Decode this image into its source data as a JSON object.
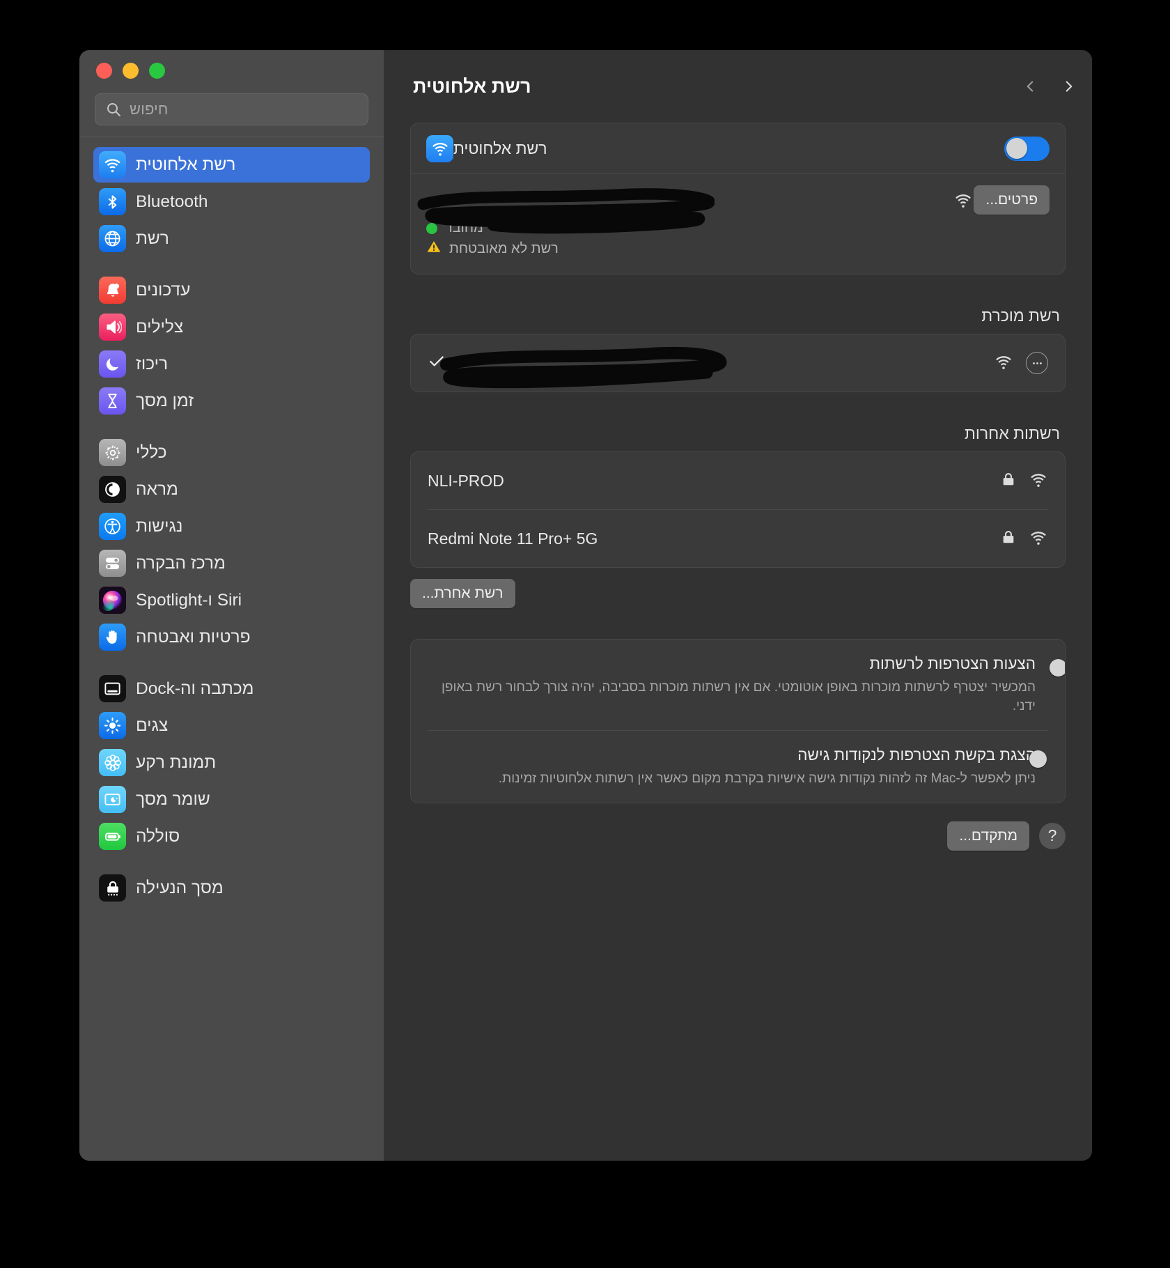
{
  "window": {
    "traffic_lights": [
      "close",
      "minimize",
      "zoom"
    ],
    "accent_color": "#3b72d9"
  },
  "search": {
    "placeholder": "חיפוש",
    "value": "",
    "icon": "search-icon"
  },
  "sidebar": {
    "groups": [
      {
        "items": [
          {
            "label": "רשת אלחוטית",
            "icon": "wifi-icon",
            "selected": true
          },
          {
            "label": "Bluetooth",
            "icon": "bluetooth-icon",
            "selected": false
          },
          {
            "label": "רשת",
            "icon": "globe-icon",
            "selected": false
          }
        ]
      },
      {
        "items": [
          {
            "label": "עדכונים",
            "icon": "bell-icon",
            "selected": false
          },
          {
            "label": "צלילים",
            "icon": "speaker-icon",
            "selected": false
          },
          {
            "label": "ריכוז",
            "icon": "moon-icon",
            "selected": false
          },
          {
            "label": "זמן מסך",
            "icon": "hourglass-icon",
            "selected": false
          }
        ]
      },
      {
        "items": [
          {
            "label": "כללי",
            "icon": "gear-icon",
            "selected": false
          },
          {
            "label": "מראה",
            "icon": "appearance-icon",
            "selected": false
          },
          {
            "label": "נגישות",
            "icon": "accessibility-icon",
            "selected": false
          },
          {
            "label": "מרכז הבקרה",
            "icon": "control-center-icon",
            "selected": false
          },
          {
            "label": "Siri ו-Spotlight",
            "icon": "siri-icon",
            "selected": false
          },
          {
            "label": "פרטיות ואבטחה",
            "icon": "hand-icon",
            "selected": false
          }
        ]
      },
      {
        "items": [
          {
            "label": "מכתבה וה-Dock",
            "icon": "desktop-dock-icon",
            "selected": false
          },
          {
            "label": "צגים",
            "icon": "brightness-icon",
            "selected": false
          },
          {
            "label": "תמונת רקע",
            "icon": "wallpaper-icon",
            "selected": false
          },
          {
            "label": "שומר מסך",
            "icon": "screensaver-icon",
            "selected": false
          },
          {
            "label": "סוללה",
            "icon": "battery-icon",
            "selected": false
          }
        ]
      },
      {
        "items": [
          {
            "label": "מסך הנעילה",
            "icon": "lock-icon",
            "selected": false
          }
        ]
      }
    ]
  },
  "main": {
    "title": "רשת אלחוטית",
    "nav": {
      "back_icon": "chevron-back-icon",
      "forward_icon": "chevron-forward-icon"
    },
    "wifi_toggle": {
      "label": "רשת אלחוטית",
      "state": "on",
      "icon": "wifi-icon"
    },
    "connected": {
      "name": "",
      "name_redacted": true,
      "details_button": "פרטים...",
      "signal_icon": "wifi-icon",
      "status": "מחובר",
      "security_warning": "רשת לא מאובטחת",
      "status_dot_color": "#29c441",
      "warning_icon": "warning-triangle-icon"
    },
    "known_section": {
      "title": "רשת מוכרת",
      "networks": [
        {
          "name": "",
          "name_redacted": true,
          "checked": true,
          "icons": [
            "wifi-icon",
            "more-options-icon"
          ]
        }
      ]
    },
    "other_section": {
      "title": "רשתות אחרות",
      "networks": [
        {
          "name": "NLI-PROD",
          "locked": true,
          "icons": [
            "lock-icon",
            "wifi-icon"
          ]
        },
        {
          "name": "Redmi Note 11 Pro+ 5G",
          "locked": true,
          "icons": [
            "lock-icon",
            "wifi-icon"
          ]
        }
      ],
      "other_network_button": "רשת אחרת..."
    },
    "options": [
      {
        "title": "הצעות הצטרפות לרשתות",
        "description": "המכשיר יצטרף לרשתות מוכרות באופן אוטומטי. אם אין רשתות מוכרות בסביבה, יהיה צורך לבחור רשת באופן ידני.",
        "state": "on"
      },
      {
        "title": "הצגת בקשת הצטרפות לנקודות גישה",
        "description": "ניתן לאפשר ל-Mac זה לזהות נקודות גישה אישיות בקרבת מקום כאשר אין רשתות אלחוטיות זמינות.",
        "state": "off"
      }
    ],
    "footer": {
      "help_label": "?",
      "advanced_button": "מתקדם..."
    }
  }
}
